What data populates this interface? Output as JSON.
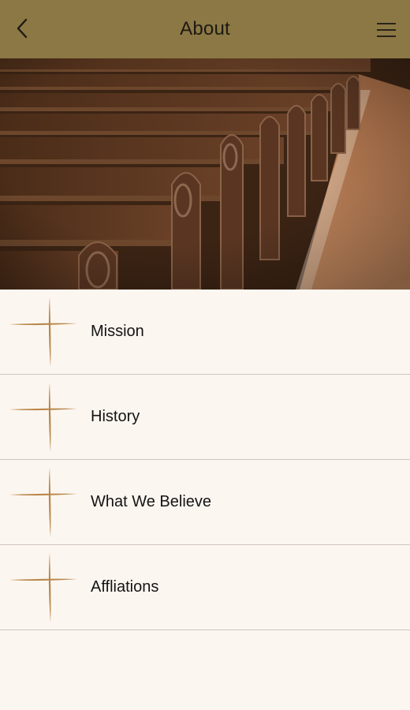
{
  "header": {
    "title": "About",
    "back_icon": "chevron-left-icon",
    "menu_icon": "hamburger-menu-icon",
    "background": "#8c7845"
  },
  "hero": {
    "description_icon": "church-pews-image"
  },
  "list": {
    "items": [
      {
        "label": "Mission",
        "icon": "cross-icon"
      },
      {
        "label": "History",
        "icon": "cross-icon"
      },
      {
        "label": "What We Believe",
        "icon": "cross-icon"
      },
      {
        "label": "Affliations",
        "icon": "cross-icon"
      }
    ]
  },
  "colors": {
    "accent": "#b8874a",
    "page_background": "#fcf6f0",
    "divider": "#cfc7be"
  }
}
